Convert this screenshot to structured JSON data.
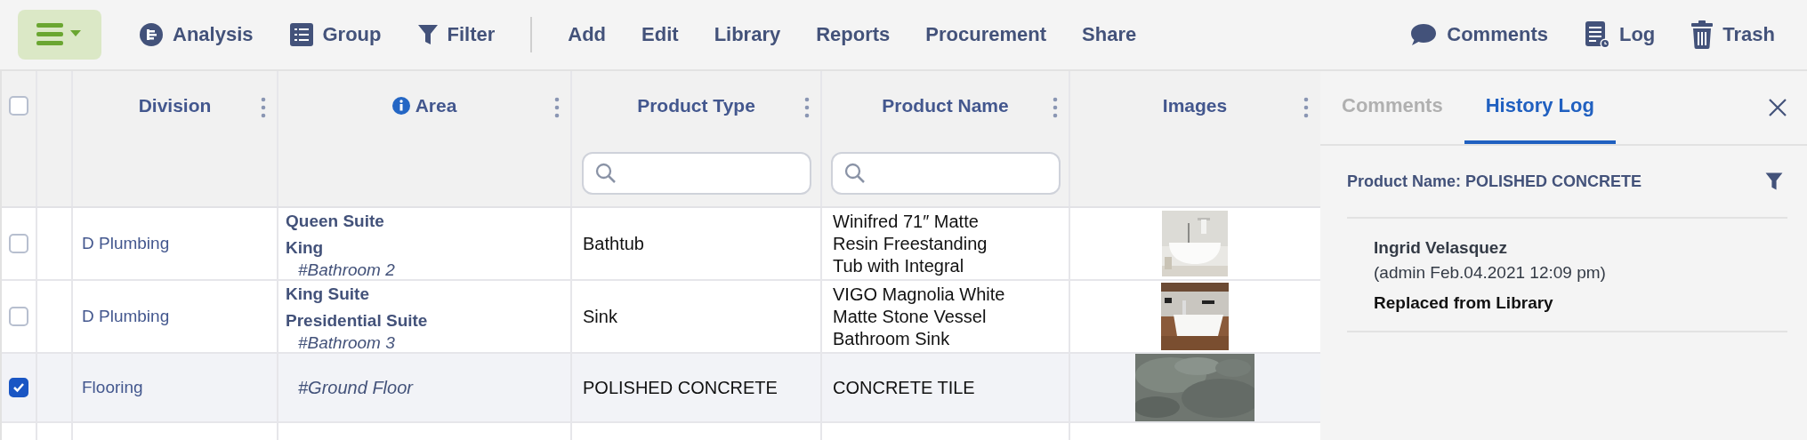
{
  "toolbar": {
    "menu_button": {
      "expanded": false
    },
    "views": [
      {
        "label": "Analysis"
      },
      {
        "label": "Group"
      },
      {
        "label": "Filter"
      }
    ],
    "actions": [
      "Add",
      "Edit",
      "Library",
      "Reports",
      "Procurement",
      "Share"
    ],
    "tools": [
      {
        "label": "Comments"
      },
      {
        "label": "Log"
      },
      {
        "label": "Trash"
      }
    ]
  },
  "table": {
    "select_all": {
      "checked": false
    },
    "columns": [
      {
        "label": "Division",
        "info": false
      },
      {
        "label": "Area",
        "info": true
      },
      {
        "label": "Product Type",
        "info": false
      },
      {
        "label": "Product Name",
        "info": false
      },
      {
        "label": "Images",
        "info": false
      }
    ],
    "filter_row": [
      {
        "kind": "empty"
      },
      {
        "kind": "empty"
      },
      {
        "kind": "search"
      },
      {
        "kind": "search"
      },
      {
        "kind": "empty"
      }
    ],
    "rows": [
      {
        "selected": false,
        "division": "D Plumbing",
        "area": [
          "Queen Suite",
          "King"
        ],
        "tag": "#Bathroom 2",
        "product_type": "Bathtub",
        "product_name": [
          "Winifred 71″ Matte",
          "Resin Freestanding",
          "Tub with Integral"
        ],
        "image": {
          "kind": "bathtub"
        }
      },
      {
        "selected": false,
        "division": "D Plumbing",
        "area": [
          "King Suite",
          "Presidential Suite"
        ],
        "tag": "#Bathroom 3",
        "product_type": "Sink",
        "product_name": [
          "VIGO Magnolia White",
          "Matte Stone Vessel",
          "Bathroom Sink"
        ],
        "image": {
          "kind": "sink"
        }
      },
      {
        "selected": true,
        "division": "Flooring",
        "area": [],
        "tag": "#Ground Floor",
        "product_type": "POLISHED CONCRETE",
        "product_name": [
          "CONCRETE TILE"
        ],
        "image": {
          "kind": "concrete"
        }
      }
    ]
  },
  "panel": {
    "tabs": [
      {
        "label": "Comments",
        "selected": false
      },
      {
        "label": "History Log",
        "selected": true
      }
    ],
    "filter_label": "Product Name: POLISHED CONCRETE",
    "entries": [
      {
        "author": "Ingrid Velasquez",
        "meta": "(admin Feb.04.2021 12:09 pm)",
        "action": "Replaced from Library"
      }
    ]
  }
}
